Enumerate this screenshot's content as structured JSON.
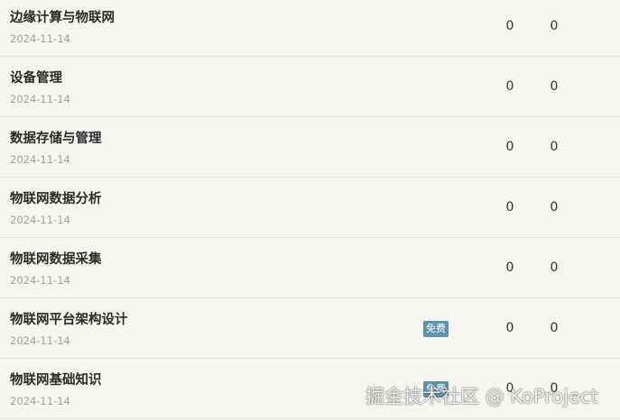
{
  "items": [
    {
      "title": "边缘计算与物联网",
      "date": "2024-11-14",
      "badge": "",
      "count1": "0",
      "count2": "0"
    },
    {
      "title": "设备管理",
      "date": "2024-11-14",
      "badge": "",
      "count1": "0",
      "count2": "0"
    },
    {
      "title": "数据存储与管理",
      "date": "2024-11-14",
      "badge": "",
      "count1": "0",
      "count2": "0"
    },
    {
      "title": "物联网数据分析",
      "date": "2024-11-14",
      "badge": "",
      "count1": "0",
      "count2": "0"
    },
    {
      "title": "物联网数据采集",
      "date": "2024-11-14",
      "badge": "",
      "count1": "0",
      "count2": "0"
    },
    {
      "title": "物联网平台架构设计",
      "date": "2024-11-14",
      "badge": "免费",
      "count1": "0",
      "count2": "0"
    },
    {
      "title": "物联网基础知识",
      "date": "2024-11-14",
      "badge": "免费",
      "count1": "0",
      "count2": "0"
    }
  ],
  "watermark": "掘金技术社区 @ KoProject",
  "colors": {
    "background": "#f6f5f1",
    "badge": "#5c93ad",
    "title": "#2b2b2b",
    "date": "#a3a19c"
  }
}
